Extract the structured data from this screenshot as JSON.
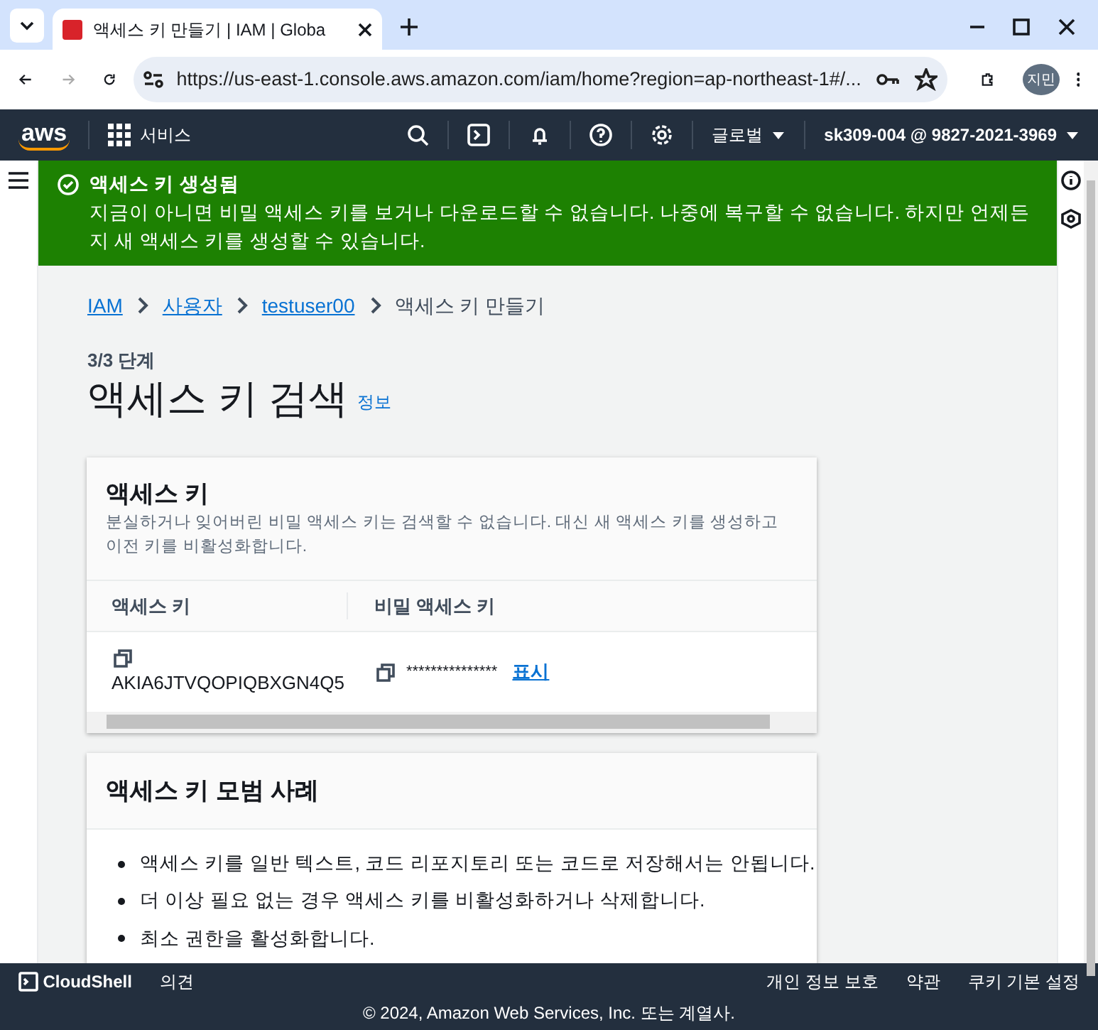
{
  "browser": {
    "tab_title": "액세스 키 만들기 | IAM | Globa",
    "url": "https://us-east-1.console.aws.amazon.com/iam/home?region=ap-northeast-1#/...",
    "profile": "지민"
  },
  "topnav": {
    "logo": "aws",
    "services": "서비스",
    "region": "글로벌",
    "account": "sk309-004 @ 9827-2021-3969"
  },
  "flash": {
    "title": "액세스 키 생성됨",
    "message": "지금이 아니면 비밀 액세스 키를 보거나 다운로드할 수 없습니다. 나중에 복구할 수 없습니다. 하지만 언제든지 새 액세스 키를 생성할 수 있습니다."
  },
  "breadcrumb": [
    {
      "label": "IAM",
      "link": true
    },
    {
      "label": "사용자",
      "link": true
    },
    {
      "label": "testuser00",
      "link": true
    },
    {
      "label": "액세스 키 만들기",
      "link": false
    }
  ],
  "step": "3/3 단계",
  "heading": "액세스 키 검색",
  "info_link": "정보",
  "access_key_card": {
    "title": "액세스 키",
    "description": "분실하거나 잊어버린 비밀 액세스 키는 검색할 수 없습니다. 대신 새 액세스 키를 생성하고 이전 키를 비활성화합니다.",
    "columns": [
      "액세스 키",
      "비밀 액세스 키"
    ],
    "access_key": "AKIA6JTVQOPIQBXGN4Q5",
    "secret_key": "***************",
    "show_link": "표시"
  },
  "best_practices": {
    "title": "액세스 키 모범 사례",
    "items": [
      "액세스 키를 일반 텍스트, 코드 리포지토리 또는 코드로 저장해서는 안됩니다.",
      "더 이상 필요 없는 경우 액세스 키를 비활성화하거나 삭제합니다.",
      "최소 권한을 활성화합니다."
    ]
  },
  "footer": {
    "cloudshell": "CloudShell",
    "feedback": "의견",
    "links": [
      "개인 정보 보호",
      "약관",
      "쿠키 기본 설정"
    ],
    "copyright": "© 2024, Amazon Web Services, Inc. 또는 계열사."
  }
}
